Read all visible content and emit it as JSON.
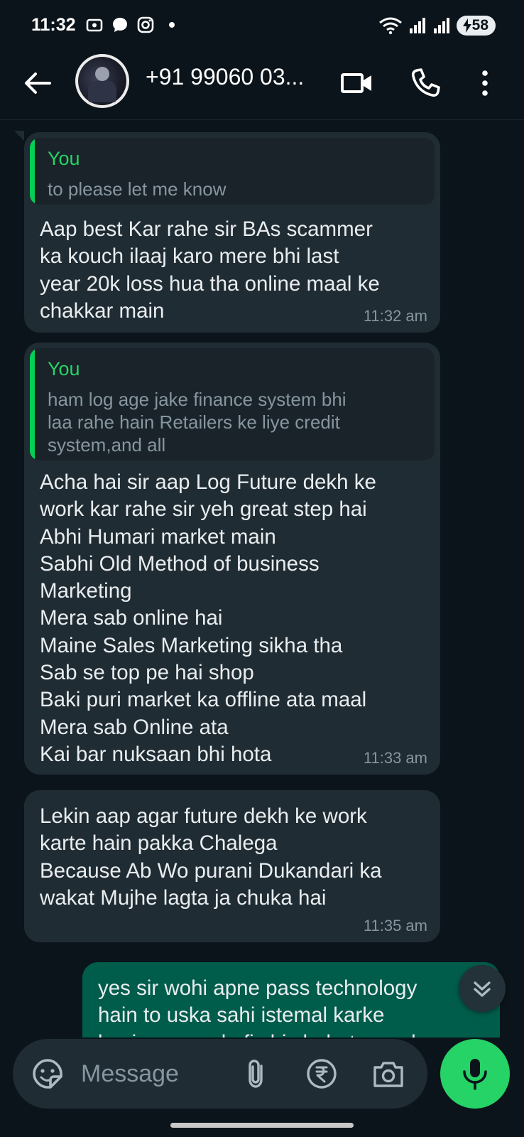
{
  "status_bar": {
    "time": "11:32",
    "battery": "58"
  },
  "header": {
    "contact": "+91 99060 03..."
  },
  "messages": [
    {
      "quote_author": "You",
      "quote_text": "to please let me know",
      "text": "Aap best Kar rahe sir BAs scammer\nka kouch ilaaj karo mere bhi last\nyear 20k loss hua tha online maal ke\nchakkar main",
      "time": "11:32 am"
    },
    {
      "quote_author": "You",
      "quote_text": "ham log age jake finance system bhi\nlaa rahe hain Retailers ke liye credit\nsystem,and all",
      "text": "Acha hai sir aap Log Future dekh ke\nwork kar rahe sir yeh great step hai\nAbhi Humari market main\nSabhi Old Method of business\nMarketing\nMera sab online hai\nMaine Sales Marketing sikha tha\nSab se top pe hai shop\nBaki puri market ka offline ata maal\nMera sab Online ata\nKai bar nuksaan bhi hota",
      "time": "11:33 am"
    },
    {
      "text": "Lekin aap agar future dekh ke work\nkarte hain pakka Chalega\nBecause Ab Wo purani Dukandari ka\nwakat Mujhe lagta ja chuka hai",
      "time": "11:35 am"
    },
    {
      "text": "yes sir wohi apne pass technology\nhain to uska sahi istemal karke\nbusiness me kafi chiz bahot easy kar"
    }
  ],
  "input": {
    "placeholder": "Message"
  },
  "colors": {
    "background": "#0b141a",
    "incoming_bubble": "#202c33",
    "outgoing_bubble": "#005c4b",
    "accent": "#25d366"
  },
  "icons": [
    "back-arrow-icon",
    "video-call-icon",
    "phone-icon",
    "more-options-icon",
    "sticker-icon",
    "attach-icon",
    "rupee-icon",
    "camera-icon",
    "mic-icon",
    "scroll-down-icon"
  ]
}
